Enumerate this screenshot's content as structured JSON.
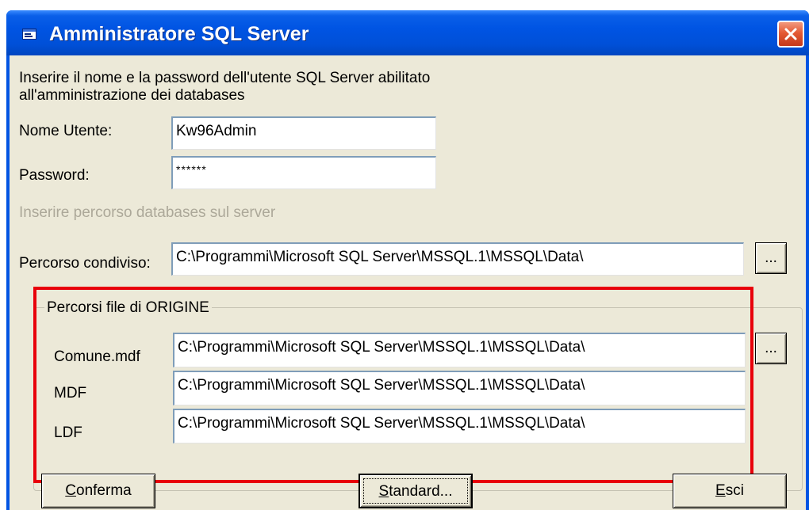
{
  "window": {
    "title": "Amministratore SQL Server"
  },
  "intro": {
    "line1": "Inserire il nome e la password dell'utente SQL Server abilitato",
    "line2": "all'amministrazione dei databases"
  },
  "login": {
    "user_label": "Nome Utente:",
    "user_value": "Kw96Admin",
    "password_label": "Password:",
    "password_value": "******"
  },
  "server_path": {
    "hint": "Inserire percorso databases sul server",
    "label": "Percorso condiviso:",
    "value": "C:\\Programmi\\Microsoft SQL Server\\MSSQL.1\\MSSQL\\Data\\",
    "browse_label": "..."
  },
  "origin_paths": {
    "group_title": "Percorsi file di ORIGINE",
    "rows": [
      {
        "label": "Comune.mdf",
        "value": "C:\\Programmi\\Microsoft SQL Server\\MSSQL.1\\MSSQL\\Data\\"
      },
      {
        "label": "MDF",
        "value": "C:\\Programmi\\Microsoft SQL Server\\MSSQL.1\\MSSQL\\Data\\"
      },
      {
        "label": "LDF",
        "value": "C:\\Programmi\\Microsoft SQL Server\\MSSQL.1\\MSSQL\\Data\\"
      }
    ],
    "browse_label": "..."
  },
  "buttons": {
    "confirm_mnemonic": "C",
    "confirm_rest": "onferma",
    "standard_mnemonic": "S",
    "standard_rest": "tandard...",
    "exit_mnemonic": "E",
    "exit_rest": "sci"
  },
  "colors": {
    "titlebar": "#0054e3",
    "dialog_background": "#ece9d8",
    "highlight_border": "#e8000b",
    "disabled_text": "#aca899"
  },
  "icons": {
    "app": "window-app-icon",
    "close": "close-icon"
  }
}
